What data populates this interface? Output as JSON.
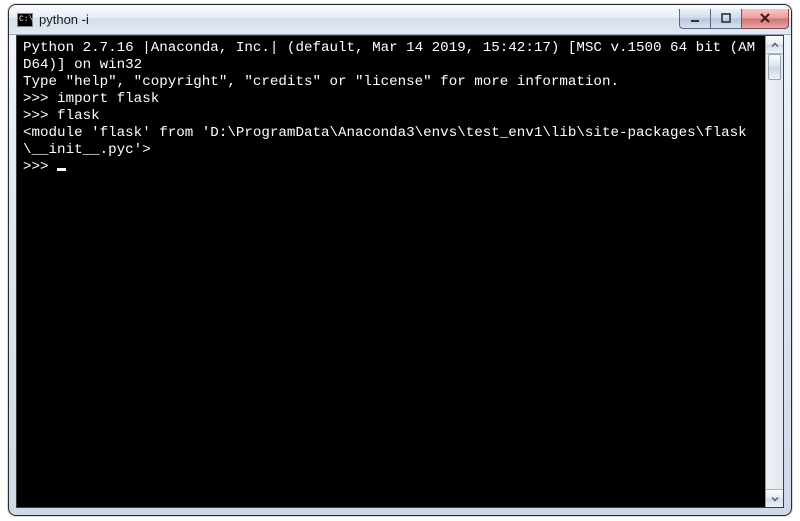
{
  "window": {
    "title": "python  -i",
    "icon_label": "C:\\"
  },
  "terminal": {
    "lines": [
      "Python 2.7.16 |Anaconda, Inc.| (default, Mar 14 2019, 15:42:17) [MSC v.1500 64 bit (AMD64)] on win32",
      "Type \"help\", \"copyright\", \"credits\" or \"license\" for more information.",
      ">>> import flask",
      ">>> flask",
      "<module 'flask' from 'D:\\ProgramData\\Anaconda3\\envs\\test_env1\\lib\\site-packages\\flask\\__init__.pyc'>",
      ">>> "
    ]
  },
  "controls": {
    "minimize": "minimize",
    "maximize": "maximize",
    "close": "close"
  }
}
